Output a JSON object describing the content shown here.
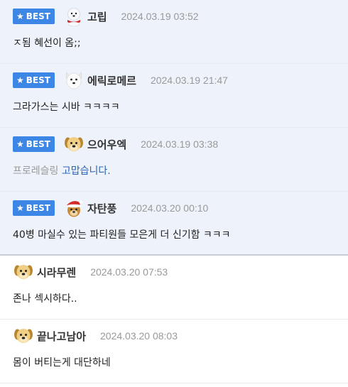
{
  "comments": [
    {
      "best": true,
      "best_label": "BEST",
      "avatar": "snowman-dog-icon",
      "nick": "고립",
      "time": "2024.03.19 03:52",
      "text": "ㅈ됨 혜선이 옴;;"
    },
    {
      "best": true,
      "best_label": "BEST",
      "avatar": "white-dog-icon",
      "nick": "에릭로메르",
      "time": "2024.03.19 21:47",
      "text": "그라가스는 시바 ㅋㅋㅋㅋ"
    },
    {
      "best": true,
      "best_label": "BEST",
      "avatar": "puppy-icon",
      "nick": "으어우엑",
      "time": "2024.03.19 03:38",
      "text_gray": "프로레슬링",
      "text_blue": "고맙습니다."
    },
    {
      "best": true,
      "best_label": "BEST",
      "avatar": "santa-dog-icon",
      "nick": "자탄풍",
      "time": "2024.03.20 00:10",
      "text": "40병 마실수 있는 파티원들 모은게 더 신기함 ㅋㅋㅋ"
    },
    {
      "best": false,
      "avatar": "puppy-icon",
      "nick": "시라무렌",
      "time": "2024.03.20 07:53",
      "text": "존나 섹시하다.."
    },
    {
      "best": false,
      "avatar": "puppy-icon",
      "nick": "끝나고남아",
      "time": "2024.03.20 08:03",
      "text": "몸이 버티는게 대단하네"
    }
  ],
  "colors": {
    "best_badge": "#3c86e6",
    "best_bg": "#eef3fb",
    "link_blue": "#2a63b8"
  }
}
